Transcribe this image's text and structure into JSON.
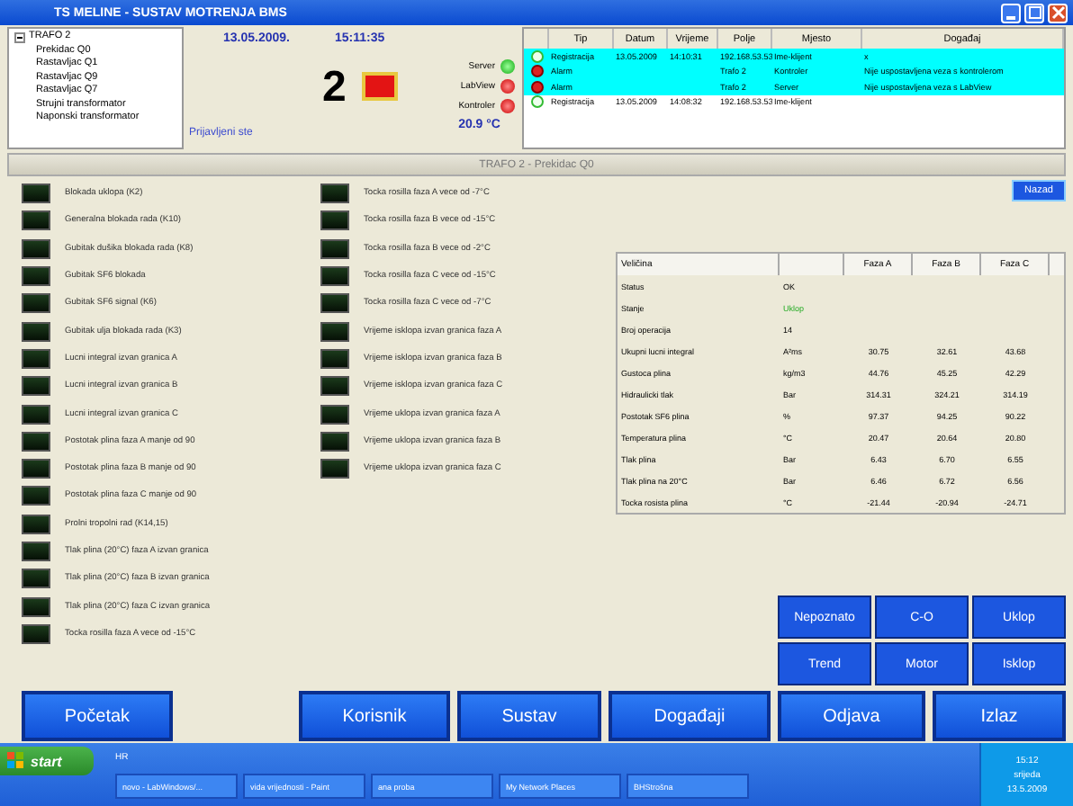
{
  "window": {
    "title": "TS MELINE  -  SUSTAV MOTRENJA BMS"
  },
  "tree": {
    "label": "TRAFO 2",
    "children": [
      {
        "label": "Prekidac Q0"
      },
      {
        "label": "Rastavljac Q1"
      },
      {
        "label": "Rastavljac Q9"
      },
      {
        "label": "Rastavljac Q7"
      },
      {
        "label": "Strujni transformator"
      },
      {
        "label": "Naponski transformator"
      }
    ]
  },
  "status": {
    "login": "Prijavljeni ste",
    "date": "13.05.2009.",
    "time": "15:11:35",
    "number": "2",
    "temperature": "20.9 °C",
    "links": [
      {
        "label": "Server",
        "ok": true
      },
      {
        "label": "LabView",
        "ok": false
      },
      {
        "label": "Kontroler",
        "ok": false
      }
    ]
  },
  "events": {
    "columns": [
      "Tip",
      "Datum",
      "Vrijeme",
      "Polje",
      "Mjesto",
      "Događaj"
    ],
    "rows": [
      {
        "ok": true,
        "selected": true,
        "cells": [
          "Registracija",
          "13.05.2009",
          "14:10:31",
          "192.168.53.53",
          "Ime-klijent",
          "x"
        ]
      },
      {
        "ok": false,
        "selected": true,
        "cells": [
          "Alarm",
          "",
          "",
          "Trafo 2",
          "Kontroler",
          "Nije uspostavljena veza s kontrolerom"
        ]
      },
      {
        "ok": false,
        "selected": true,
        "cells": [
          "Alarm",
          "",
          "",
          "Trafo 2",
          "Server",
          "Nije uspostavljena veza s LabView"
        ]
      },
      {
        "ok": true,
        "selected": false,
        "cells": [
          "Registracija",
          "13.05.2009",
          "14:08:32",
          "192.168.53.53",
          "Ime-klijent",
          ""
        ]
      }
    ]
  },
  "section_title": "TRAFO 2 - Prekidac Q0",
  "back_button": "Nazad",
  "indicators_left": [
    {
      "label": "Blokada uklopa (K2)",
      "on": false
    },
    {
      "label": "Generalna blokada rada (K10)",
      "on": false
    },
    {
      "label": "Gubitak dušika blokada rada (K8)",
      "on": false
    },
    {
      "label": "Gubitak SF6 blokada",
      "on": false
    },
    {
      "label": "Gubitak SF6 signal (K6)",
      "on": false
    },
    {
      "label": "Gubitak ulja blokada rada (K3)",
      "on": false
    },
    {
      "label": "Lucni integral izvan granica A",
      "on": false
    },
    {
      "label": "Lucni integral izvan granica B",
      "on": false
    },
    {
      "label": "Lucni integral izvan granica C",
      "on": false
    },
    {
      "label": "Postotak plina faza A manje od 90",
      "on": false
    },
    {
      "label": "Postotak plina faza B manje od 90",
      "on": false
    },
    {
      "label": "Postotak plina faza C manje od 90",
      "on": false
    },
    {
      "label": "Prolni tropolni rad (K14,15)",
      "on": false
    },
    {
      "label": "Tlak plina (20°C) faza A izvan granica",
      "on": false
    },
    {
      "label": "Tlak plina (20°C) faza B izvan granica",
      "on": false
    },
    {
      "label": "Tlak plina (20°C) faza C izvan granica",
      "on": false
    },
    {
      "label": "Tocka rosilla faza A vece od -15°C",
      "on": false
    }
  ],
  "indicators_right": [
    {
      "label": "Tocka rosilla faza A vece od -7°C",
      "on": false
    },
    {
      "label": "Tocka rosilla faza B vece od -15°C",
      "on": false
    },
    {
      "label": "Tocka rosilla faza B vece od -2°C",
      "on": false
    },
    {
      "label": "Tocka rosilla faza C vece od -15°C",
      "on": false
    },
    {
      "label": "Tocka rosilla faza C vece od -7°C",
      "on": false
    },
    {
      "label": "Vrijeme isklopa izvan granica faza A",
      "on": false
    },
    {
      "label": "Vrijeme isklopa izvan granica faza B",
      "on": false
    },
    {
      "label": "Vrijeme isklopa izvan granica faza C",
      "on": false
    },
    {
      "label": "Vrijeme uklopa izvan granica faza A",
      "on": false
    },
    {
      "label": "Vrijeme uklopa izvan granica faza B",
      "on": false
    },
    {
      "label": "Vrijeme uklopa izvan granica faza C",
      "on": false
    }
  ],
  "values_table": {
    "columns": [
      "Veličina",
      "",
      "Faza A",
      "Faza B",
      "Faza C"
    ],
    "rows": [
      {
        "highlight": false,
        "cells": [
          "Status",
          "OK",
          "",
          "",
          ""
        ]
      },
      {
        "highlight": true,
        "cells": [
          "Stanje",
          "Uklop",
          "",
          "",
          ""
        ]
      },
      {
        "highlight": false,
        "cells": [
          "Broj operacija",
          "14",
          "",
          "",
          ""
        ]
      },
      {
        "highlight": false,
        "cells": [
          "Ukupni lucni integral",
          "A²ms",
          "30.75",
          "32.61",
          "43.68"
        ]
      },
      {
        "highlight": false,
        "cells": [
          "Gustoca plina",
          "kg/m3",
          "44.76",
          "45.25",
          "42.29"
        ]
      },
      {
        "highlight": false,
        "cells": [
          "Hidraulicki tlak",
          "Bar",
          "314.31",
          "324.21",
          "314.19"
        ]
      },
      {
        "highlight": false,
        "cells": [
          "Postotak SF6 plina",
          "%",
          "97.37",
          "94.25",
          "90.22"
        ]
      },
      {
        "highlight": false,
        "cells": [
          "Temperatura plina",
          "°C",
          "20.47",
          "20.64",
          "20.80"
        ]
      },
      {
        "highlight": false,
        "cells": [
          "Tlak plina",
          "Bar",
          "6.43",
          "6.70",
          "6.55"
        ]
      },
      {
        "highlight": false,
        "cells": [
          "Tlak plina na 20°C",
          "Bar",
          "6.46",
          "6.72",
          "6.56"
        ]
      },
      {
        "highlight": false,
        "cells": [
          "Tocka rosista plina",
          "°C",
          "-21.44",
          "-20.94",
          "-24.71"
        ]
      }
    ]
  },
  "action_buttons": [
    "Nepoznato",
    "C-O",
    "Uklop",
    "Trend",
    "Motor",
    "Isklop"
  ],
  "nav_buttons": [
    "Početak",
    "Korisnik",
    "Sustav",
    "Događaji",
    "Odjava",
    "Izlaz"
  ],
  "taskbar": {
    "start": "start",
    "language": "HR",
    "tasks": [
      "novo - LabWindows/...",
      "vida vrijednosti - Paint",
      "ana proba",
      "My Network Places",
      "BHStrošna"
    ],
    "clock": [
      "15:12",
      "srijeda",
      "13.5.2009"
    ]
  }
}
